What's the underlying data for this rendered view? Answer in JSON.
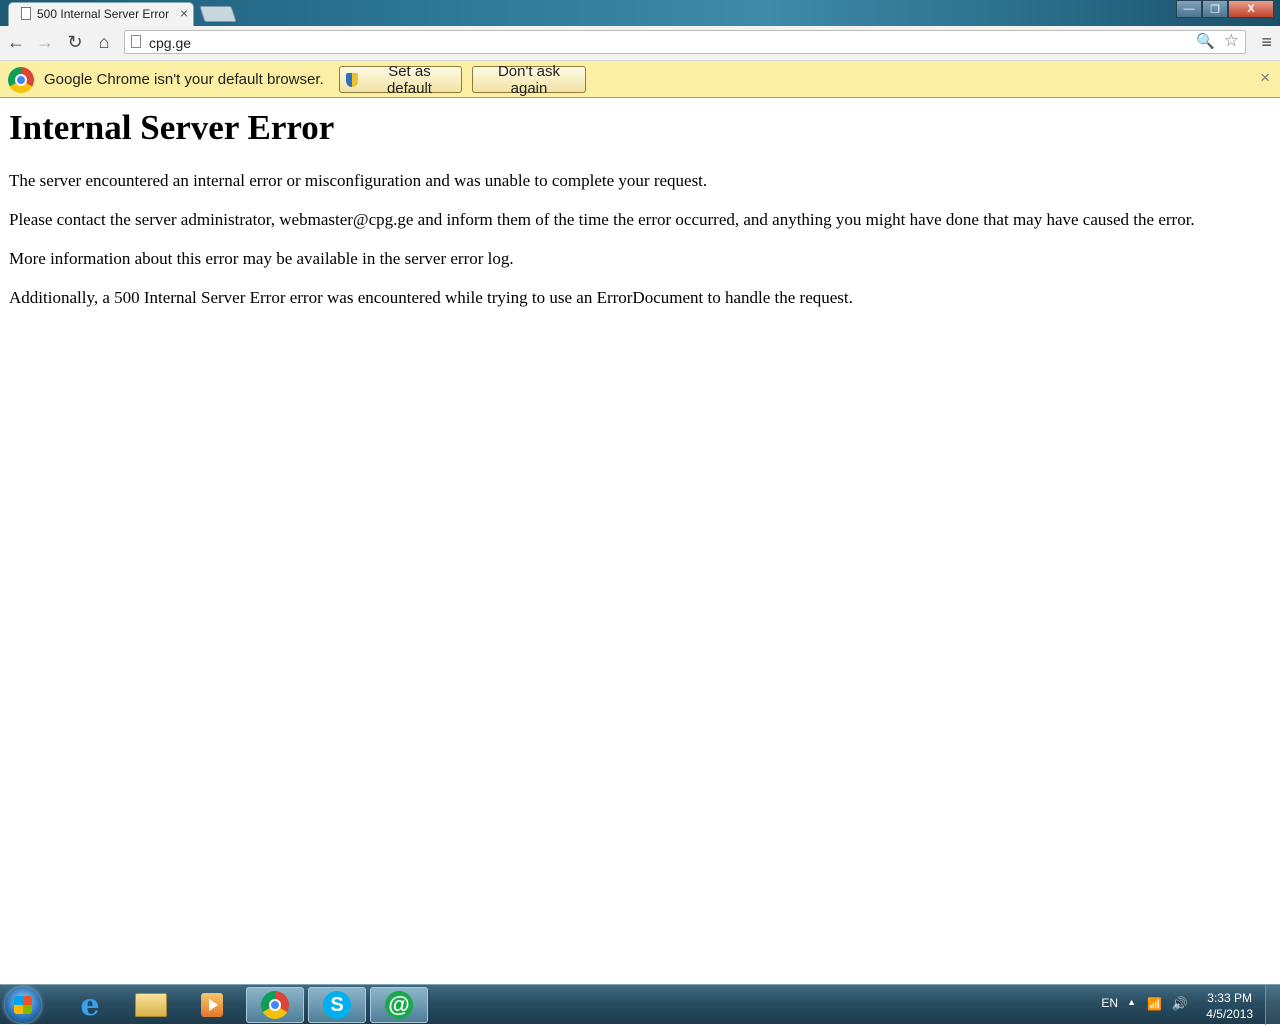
{
  "browser": {
    "tab_title": "500 Internal Server Error",
    "tab_close": "×",
    "window_controls": {
      "minimize": "—",
      "maximize": "❐",
      "close": "X"
    },
    "nav": {
      "back": "←",
      "forward": "→",
      "reload": "↻",
      "home": "⌂"
    },
    "address": "cpg.ge",
    "zoom_icon": "🔍",
    "star_icon": "☆",
    "menu_icon": "≡"
  },
  "infobar": {
    "message": "Google Chrome isn't your default browser.",
    "set_default_label": "Set as default",
    "dont_ask_label": "Don't ask again",
    "close": "×"
  },
  "page": {
    "heading": "Internal Server Error",
    "paragraphs": [
      "The server encountered an internal error or misconfiguration and was unable to complete your request.",
      "Please contact the server administrator, webmaster@cpg.ge and inform them of the time the error occurred, and anything you might have done that may have caused the error.",
      "More information about this error may be available in the server error log.",
      "Additionally, a 500 Internal Server Error error was encountered while trying to use an ErrorDocument to handle the request."
    ]
  },
  "taskbar": {
    "apps": [
      "internet-explorer",
      "windows-explorer",
      "media-player",
      "google-chrome",
      "skype",
      "mail-agent"
    ],
    "skype_glyph": "S",
    "mail_glyph": "@",
    "ie_glyph": "e",
    "language": "EN",
    "tray_up": "▲",
    "network_glyph": "📶",
    "volume_glyph": "🔊",
    "time": "3:33 PM",
    "date": "4/5/2013"
  }
}
